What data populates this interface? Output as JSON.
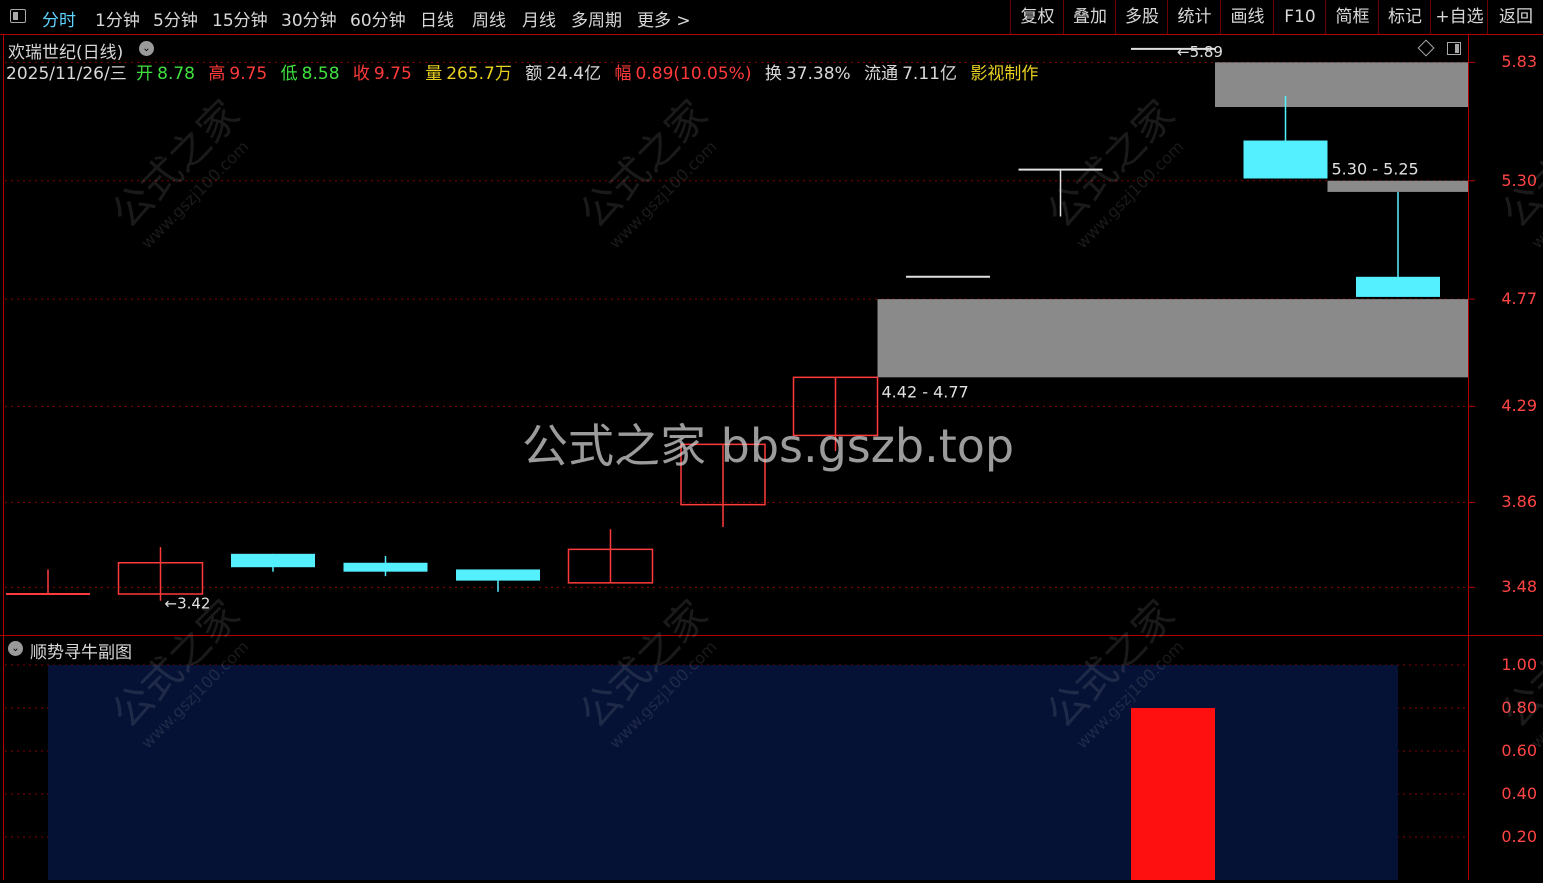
{
  "toolbar": {
    "left_items": [
      "分时",
      "1分钟",
      "5分钟",
      "15分钟",
      "30分钟",
      "60分钟",
      "日线",
      "周线",
      "月线",
      "多周期",
      "更多 >"
    ],
    "active": "分时",
    "right_items": [
      "复权",
      "叠加",
      "多股",
      "统计",
      "画线",
      "F10",
      "简框",
      "标记",
      "+自选",
      "返回"
    ]
  },
  "stock": {
    "name": "欢瑞世纪(日线)",
    "date": "2025/11/26/三",
    "open_label": "开",
    "open": "8.78",
    "high_label": "高",
    "high": "9.75",
    "low_label": "低",
    "low": "8.58",
    "close_label": "收",
    "close": "9.75",
    "vol_label": "量",
    "vol": "265.7万",
    "amount_label": "额",
    "amount": "24.4亿",
    "change_label": "幅",
    "change": "0.89(10.05%)",
    "turnover_label": "换",
    "turnover": "37.38%",
    "float_label": "流通",
    "float": "7.11亿",
    "credit": "影视制作"
  },
  "subchart": {
    "title": "顺势寻牛副图"
  },
  "watermarks": {
    "center": "公式之家 bbs.gszb.top",
    "diag_cn": "公式之家",
    "diag_url": "www.gszj100.com"
  },
  "colors": {
    "up": "#ff3a3a",
    "down": "#55f0ff",
    "zone": "#8a8a8a",
    "axis": "#ff4444"
  },
  "chart_data": [
    {
      "type": "candlestick",
      "y_ticks": [
        "5.83",
        "5.30",
        "4.77",
        "4.29",
        "3.86",
        "3.48"
      ],
      "ylim": [
        3.28,
        5.93
      ],
      "candles": [
        {
          "o": 3.45,
          "c": 3.45,
          "h": 3.56,
          "l": 3.45,
          "dir": "flat"
        },
        {
          "o": 3.45,
          "c": 3.59,
          "h": 3.66,
          "l": 3.42,
          "dir": "up"
        },
        {
          "o": 3.63,
          "c": 3.57,
          "h": 3.63,
          "l": 3.55,
          "dir": "down"
        },
        {
          "o": 3.59,
          "c": 3.55,
          "h": 3.62,
          "l": 3.53,
          "dir": "down"
        },
        {
          "o": 3.56,
          "c": 3.51,
          "h": 3.56,
          "l": 3.46,
          "dir": "down"
        },
        {
          "o": 3.5,
          "c": 3.65,
          "h": 3.74,
          "l": 3.5,
          "dir": "up"
        },
        {
          "o": 3.85,
          "c": 4.12,
          "h": 4.12,
          "l": 3.75,
          "dir": "up"
        },
        {
          "o": 4.16,
          "c": 4.42,
          "h": 4.42,
          "l": 4.09,
          "dir": "up"
        },
        {
          "o": 4.87,
          "c": 4.87,
          "h": 4.87,
          "l": 4.87,
          "dir": "flat"
        },
        {
          "o": 5.35,
          "c": 5.35,
          "h": 5.35,
          "l": 5.14,
          "dir": "flat"
        },
        {
          "o": 5.89,
          "c": 5.89,
          "h": 5.89,
          "l": 5.89,
          "dir": "flat"
        },
        {
          "o": 5.48,
          "c": 5.31,
          "h": 5.68,
          "l": 5.31,
          "dir": "down"
        },
        {
          "o": 4.87,
          "c": 4.78,
          "h": 5.25,
          "l": 4.78,
          "dir": "down"
        }
      ],
      "zones": [
        {
          "from_index": 7,
          "low": 4.42,
          "high": 4.77,
          "label": "4.42 - 4.77"
        },
        {
          "from_index": 11,
          "low": 5.25,
          "high": 5.3,
          "label": "5.30 - 5.25"
        },
        {
          "from_index": 10,
          "low": 5.63,
          "high": 5.83,
          "label": ""
        }
      ],
      "annotations": [
        {
          "index": 1,
          "value": "3.42",
          "text": "←3.42"
        },
        {
          "index": 10,
          "value": "5.89",
          "text": "←5.89"
        }
      ]
    },
    {
      "type": "bar",
      "title": "顺势寻牛副图",
      "y_ticks": [
        "1.00",
        "0.80",
        "0.60",
        "0.40",
        "0.20"
      ],
      "ylim": [
        0,
        1.05
      ],
      "background_band": {
        "from_index": 0,
        "to_index": 12,
        "value": 1.0,
        "color": "#061235"
      },
      "values": [
        0,
        0,
        0,
        0,
        0,
        0,
        0,
        0,
        0,
        0,
        0.8,
        0,
        0
      ]
    }
  ]
}
